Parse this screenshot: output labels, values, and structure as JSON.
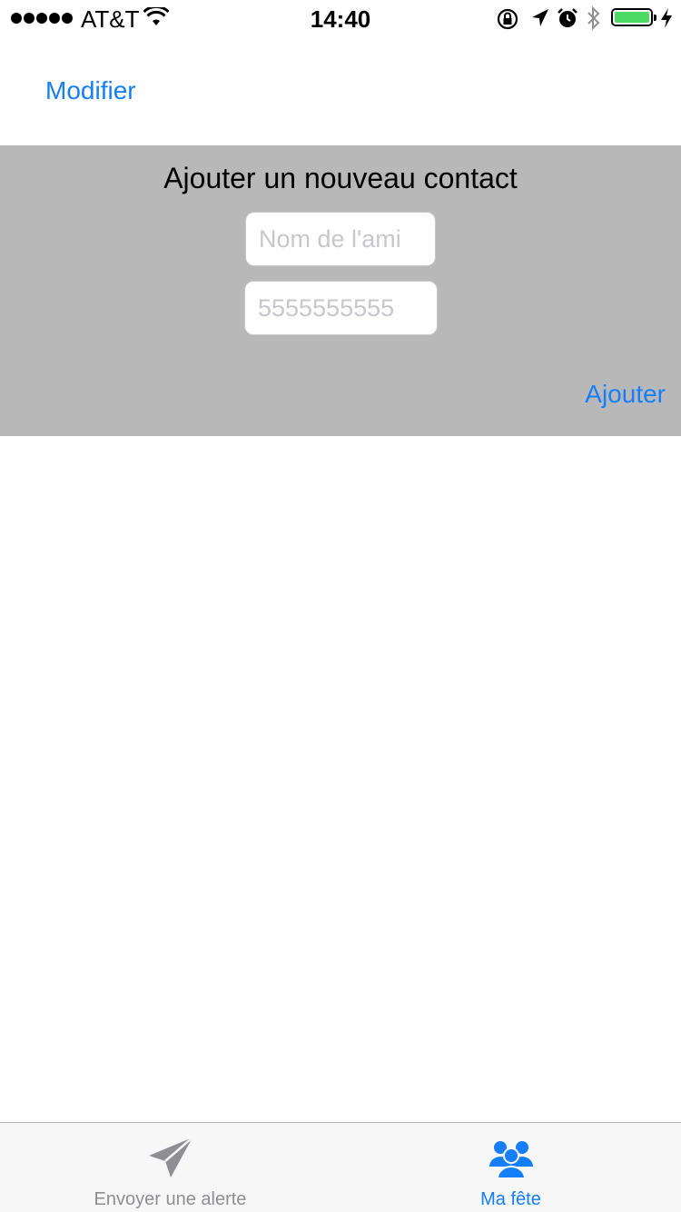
{
  "status_bar": {
    "carrier": "AT&T",
    "time": "14:40",
    "battery_color": "#4cd964"
  },
  "nav": {
    "edit_label": "Modifier"
  },
  "add_contact": {
    "title": "Ajouter un nouveau contact",
    "name_placeholder": "Nom de l'ami",
    "phone_placeholder": "5555555555",
    "add_label": "Ajouter"
  },
  "tabs": [
    {
      "label": "Envoyer une alerte",
      "icon": "paper-plane-icon",
      "selected": false
    },
    {
      "label": "Ma fête",
      "icon": "group-icon",
      "selected": true
    }
  ],
  "colors": {
    "accent": "#147efb",
    "panel_background": "#b8b8b8",
    "tab_inactive": "#8e8e93"
  }
}
